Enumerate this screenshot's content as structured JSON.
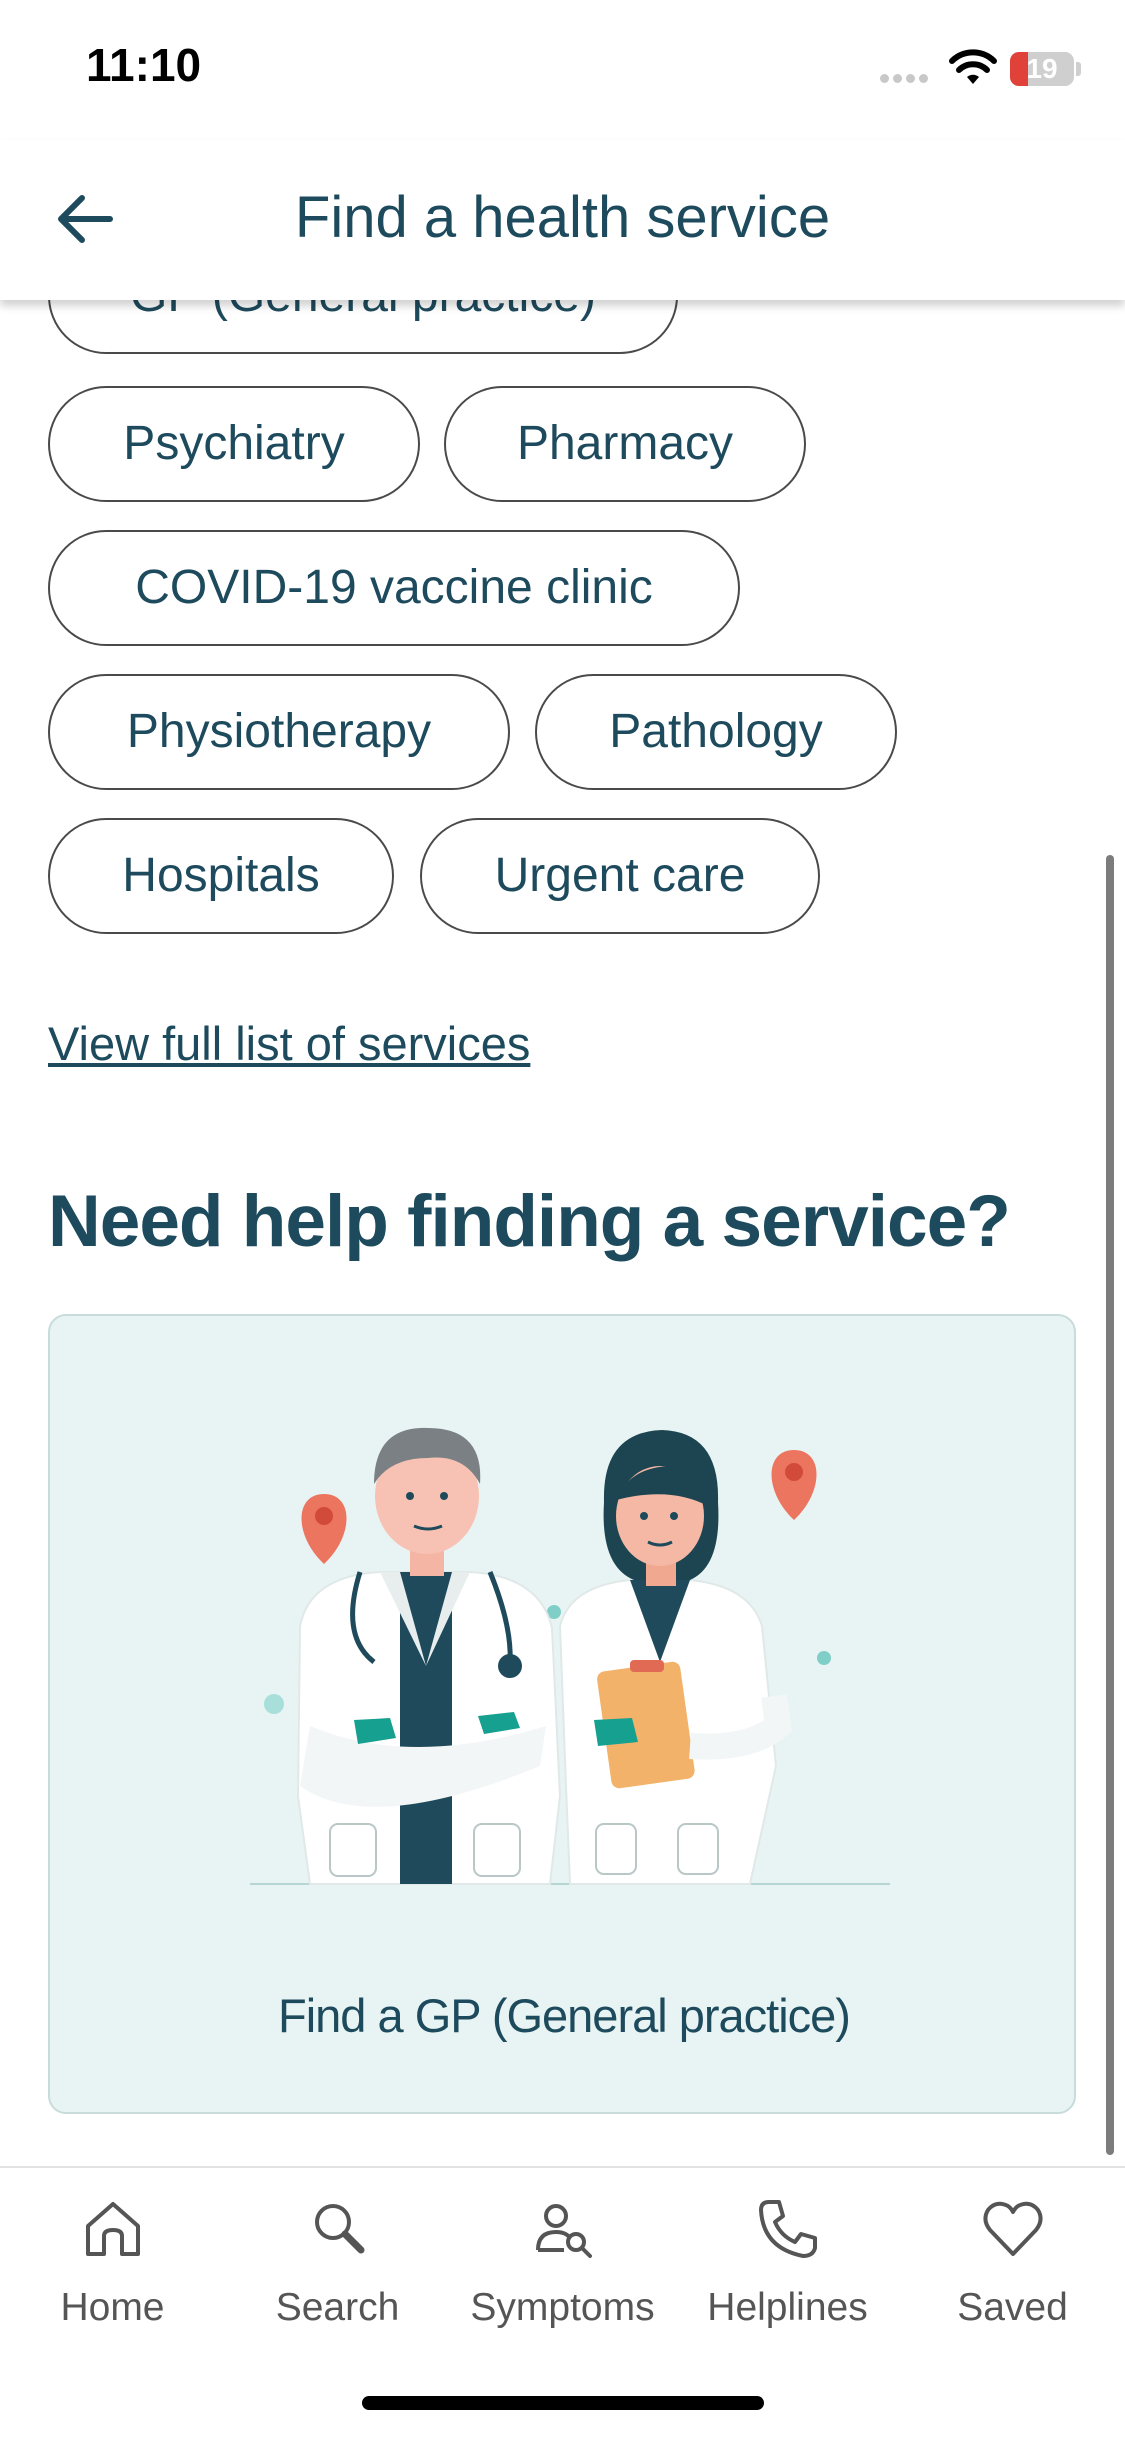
{
  "status_bar": {
    "time": "11:10",
    "battery": "19"
  },
  "header": {
    "title": "Find a health service",
    "back_icon": "arrow-left-icon"
  },
  "chips": [
    {
      "label": "GP (General practice)"
    },
    {
      "label": "Psychiatry"
    },
    {
      "label": "Pharmacy"
    },
    {
      "label": "COVID-19 vaccine clinic"
    },
    {
      "label": "Physiotherapy"
    },
    {
      "label": "Pathology"
    },
    {
      "label": "Hospitals"
    },
    {
      "label": "Urgent care"
    }
  ],
  "view_full_list": "View full list of services",
  "help_heading": "Need help finding a service?",
  "gp_card": {
    "label": "Find a GP (General practice)"
  },
  "tab_bar": {
    "items": [
      {
        "label": "Home",
        "icon": "home-icon"
      },
      {
        "label": "Search",
        "icon": "search-icon"
      },
      {
        "label": "Symptoms",
        "icon": "symptoms-icon"
      },
      {
        "label": "Helplines",
        "icon": "phone-icon"
      },
      {
        "label": "Saved",
        "icon": "heart-icon"
      }
    ]
  },
  "colors": {
    "primary": "#1d4a5c",
    "card_bg": "#e8f4f3",
    "teal": "#16a08f",
    "pin": "#ec7560"
  }
}
